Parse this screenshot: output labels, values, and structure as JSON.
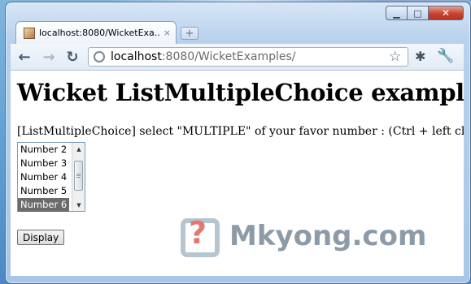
{
  "browser": {
    "tab": {
      "title": "localhost:8080/WicketExa...",
      "close_glyph": "×",
      "icon": "page-favicon-icon"
    },
    "new_tab_glyph": "+",
    "caption": {
      "minimize": "▁",
      "maximize": "□",
      "close": "✕"
    },
    "nav": {
      "back": "←",
      "forward": "→",
      "reload": "↻"
    },
    "address": {
      "host": "localhost",
      "rest": ":8080/WicketExamples/"
    },
    "icons": {
      "star": "☆",
      "extension": "✱",
      "wrench": "🔧"
    }
  },
  "page": {
    "title": "Wicket ListMultipleChoice example",
    "prompt": "[ListMultipleChoice] select \"MULTIPLE\" of your favor number : (Ctrl + left click)",
    "list": {
      "options": [
        {
          "label": "Number 2",
          "selected": false
        },
        {
          "label": "Number 3",
          "selected": false
        },
        {
          "label": "Number 4",
          "selected": false
        },
        {
          "label": "Number 5",
          "selected": false
        },
        {
          "label": "Number 6",
          "selected": true
        }
      ],
      "scroll_up": "▲",
      "scroll_down": "▼"
    },
    "submit_label": "Display"
  },
  "watermark": {
    "glyph": "?",
    "text": "Mkyong.com"
  }
}
